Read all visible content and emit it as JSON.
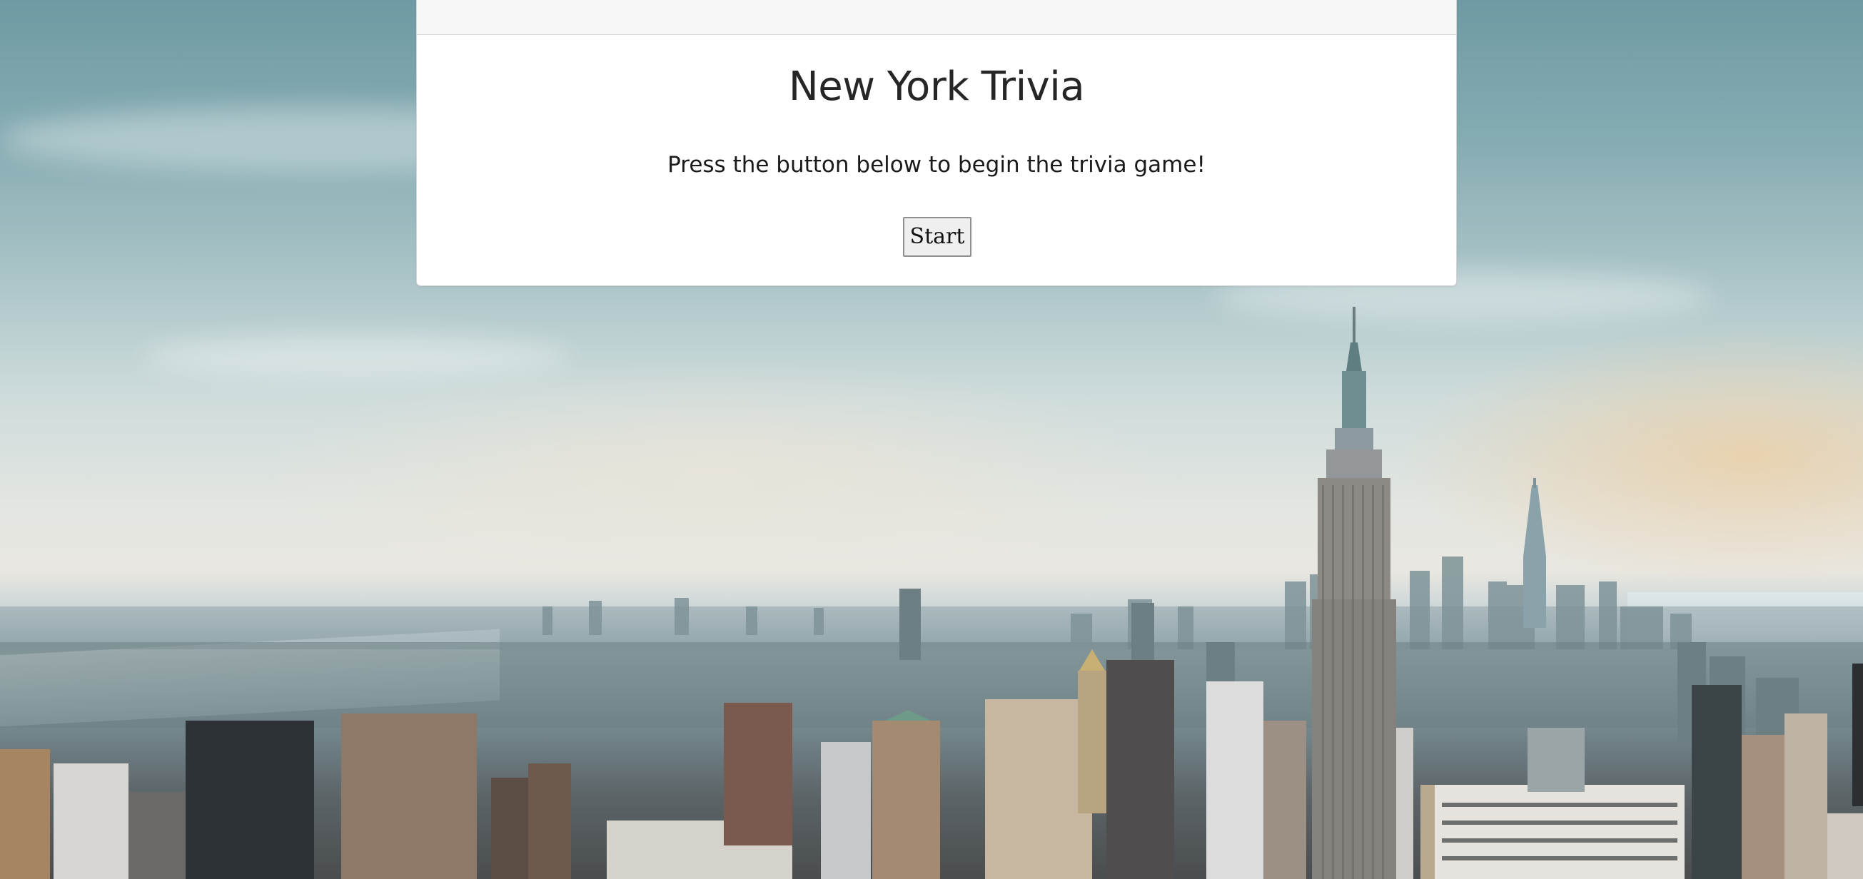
{
  "page": {
    "background": "new-york-city-skyline"
  },
  "card": {
    "title": "New York Trivia",
    "instructions": "Press the button below to begin the trivia game!",
    "start_label": "Start"
  },
  "colors": {
    "card_background": "#ffffff",
    "card_header": "#f7f7f7",
    "title_text": "#262626",
    "button_background": "#efefef",
    "button_border": "#8f8f8f"
  }
}
